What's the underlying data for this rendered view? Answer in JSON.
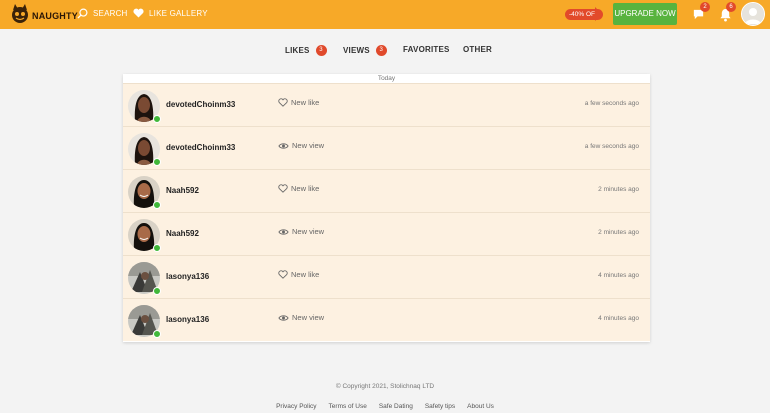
{
  "header": {
    "logo_text": "NAUGHTY",
    "nav": {
      "search": "SEARCH",
      "like_gallery": "LIKE GALLERY"
    },
    "promo": "-40% OFF",
    "upgrade": "UPGRADE NOW",
    "messages_count": "2",
    "notifications_count": "6",
    "colors": {
      "bar": "#f7a928",
      "upgrade": "#58b33e",
      "badge": "#e24a2a"
    }
  },
  "tabs": [
    {
      "label": "LIKES",
      "count": "3"
    },
    {
      "label": "VIEWS",
      "count": "3"
    },
    {
      "label": "FAVORITES"
    },
    {
      "label": "OTHER"
    }
  ],
  "feed": {
    "day": "Today",
    "rows": [
      {
        "user": "devotedChoinm33",
        "event": "New like",
        "event_icon": "heart-icon",
        "time": "a few seconds ago"
      },
      {
        "user": "devotedChoinm33",
        "event": "New view",
        "event_icon": "eye-icon",
        "time": "a few seconds ago"
      },
      {
        "user": "Naah592",
        "event": "New like",
        "event_icon": "heart-icon",
        "time": "2 minutes ago"
      },
      {
        "user": "Naah592",
        "event": "New view",
        "event_icon": "eye-icon",
        "time": "2 minutes ago"
      },
      {
        "user": "lasonya136",
        "event": "New like",
        "event_icon": "heart-icon",
        "time": "4 minutes ago"
      },
      {
        "user": "lasonya136",
        "event": "New view",
        "event_icon": "eye-icon",
        "time": "4 minutes ago"
      }
    ]
  },
  "footer": {
    "copyright": "© Copyright 2021, Stolichnaq LTD",
    "links": [
      "Privacy Policy",
      "Terms of Use",
      "Safe Dating",
      "Safety tips",
      "About Us"
    ]
  }
}
